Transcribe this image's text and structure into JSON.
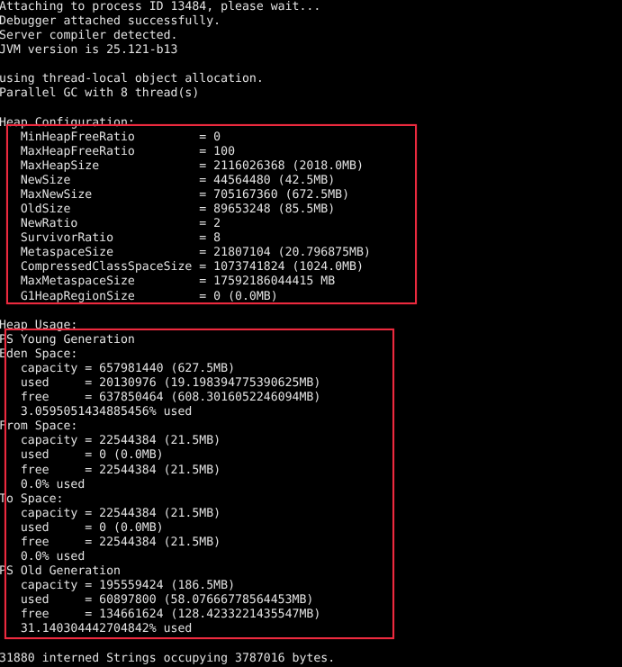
{
  "window": {
    "kind": "console-terminal",
    "background_color": "#000000",
    "text_color": "#e3e3e3",
    "highlight_color": "#ec2a3f"
  },
  "console": {
    "lines": [
      "Attaching to process ID 13484, please wait...",
      "Debugger attached successfully.",
      "Server compiler detected.",
      "JVM version is 25.121-b13",
      "",
      "using thread-local object allocation.",
      "Parallel GC with 8 thread(s)",
      "",
      "Heap Configuration:",
      "   MinHeapFreeRatio         = 0",
      "   MaxHeapFreeRatio         = 100",
      "   MaxHeapSize              = 2116026368 (2018.0MB)",
      "   NewSize                  = 44564480 (42.5MB)",
      "   MaxNewSize               = 705167360 (672.5MB)",
      "   OldSize                  = 89653248 (85.5MB)",
      "   NewRatio                 = 2",
      "   SurvivorRatio            = 8",
      "   MetaspaceSize            = 21807104 (20.796875MB)",
      "   CompressedClassSpaceSize = 1073741824 (1024.0MB)",
      "   MaxMetaspaceSize         = 17592186044415 MB",
      "   G1HeapRegionSize         = 0 (0.0MB)",
      "",
      "Heap Usage:",
      "PS Young Generation",
      "Eden Space:",
      "   capacity = 657981440 (627.5MB)",
      "   used     = 20130976 (19.198394775390625MB)",
      "   free     = 637850464 (608.3016052246094MB)",
      "   3.0595051434885456% used",
      "From Space:",
      "   capacity = 22544384 (21.5MB)",
      "   used     = 0 (0.0MB)",
      "   free     = 22544384 (21.5MB)",
      "   0.0% used",
      "To Space:",
      "   capacity = 22544384 (21.5MB)",
      "   used     = 0 (0.0MB)",
      "   free     = 22544384 (21.5MB)",
      "   0.0% used",
      "PS Old Generation",
      "   capacity = 195559424 (186.5MB)",
      "   used     = 60897800 (58.07666778564453MB)",
      "   free     = 134661624 (128.4233221435547MB)",
      "   31.140304442704842% used",
      "",
      "31880 interned Strings occupying 3787016 bytes."
    ]
  },
  "sections": {
    "attach": {
      "process_id": "13484",
      "attach_line": "Attaching to process ID 13484, please wait...",
      "debugger_line": "Debugger attached successfully.",
      "compiler_line": "Server compiler detected.",
      "jvm_version_line": "JVM version is 25.121-b13",
      "jvm_version": "25.121-b13",
      "allocation_line": "using thread-local object allocation.",
      "gc_line": "Parallel GC with 8 thread(s)",
      "gc_threads": "8"
    },
    "heap_configuration": {
      "title": "Heap Configuration:",
      "highlighted": true,
      "entries": [
        {
          "name": "MinHeapFreeRatio",
          "value": "0"
        },
        {
          "name": "MaxHeapFreeRatio",
          "value": "100"
        },
        {
          "name": "MaxHeapSize",
          "value": "2116026368 (2018.0MB)"
        },
        {
          "name": "NewSize",
          "value": "44564480 (42.5MB)"
        },
        {
          "name": "MaxNewSize",
          "value": "705167360 (672.5MB)"
        },
        {
          "name": "OldSize",
          "value": "89653248 (85.5MB)"
        },
        {
          "name": "NewRatio",
          "value": "2"
        },
        {
          "name": "SurvivorRatio",
          "value": "8"
        },
        {
          "name": "MetaspaceSize",
          "value": "21807104 (20.796875MB)"
        },
        {
          "name": "CompressedClassSpaceSize",
          "value": "1073741824 (1024.0MB)"
        },
        {
          "name": "MaxMetaspaceSize",
          "value": "17592186044415 MB"
        },
        {
          "name": "G1HeapRegionSize",
          "value": "0 (0.0MB)"
        }
      ]
    },
    "heap_usage": {
      "title": "Heap Usage:",
      "highlighted": true,
      "generations": [
        {
          "name": "PS Young Generation",
          "spaces": [
            {
              "name": "Eden Space:",
              "capacity": "657981440 (627.5MB)",
              "used": "20130976 (19.198394775390625MB)",
              "free": "637850464 (608.3016052246094MB)",
              "percent_used": "3.0595051434885456% used"
            },
            {
              "name": "From Space:",
              "capacity": "22544384 (21.5MB)",
              "used": "0 (0.0MB)",
              "free": "22544384 (21.5MB)",
              "percent_used": "0.0% used"
            },
            {
              "name": "To Space:",
              "capacity": "22544384 (21.5MB)",
              "used": "0 (0.0MB)",
              "free": "22544384 (21.5MB)",
              "percent_used": "0.0% used"
            }
          ]
        },
        {
          "name": "PS Old Generation",
          "spaces": [
            {
              "name": "",
              "capacity": "195559424 (186.5MB)",
              "used": "60897800 (58.07666778564453MB)",
              "free": "134661624 (128.4233221435547MB)",
              "percent_used": "31.140304442704842% used"
            }
          ]
        }
      ]
    },
    "footer": {
      "interned_strings_line": "31880 interned Strings occupying 3787016 bytes.",
      "interned_count": "31880",
      "interned_bytes": "3787016"
    }
  },
  "annotations": {
    "boxes": [
      {
        "label": "heap-configuration-highlight",
        "color": "#ec2a3f"
      },
      {
        "label": "heap-usage-highlight",
        "color": "#ec2a3f"
      }
    ]
  }
}
